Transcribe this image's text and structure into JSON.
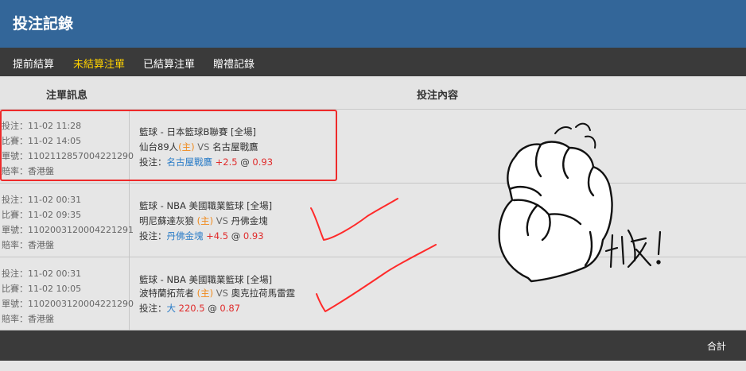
{
  "header": {
    "title": "投注記錄"
  },
  "tabs": [
    {
      "label": "提前結算",
      "active": false
    },
    {
      "label": "未結算注單",
      "active": true
    },
    {
      "label": "已結算注單",
      "active": false
    },
    {
      "label": "贈禮記錄",
      "active": false
    }
  ],
  "columns": {
    "info": "注單訊息",
    "content": "投注內容"
  },
  "bets": [
    {
      "bet_time": "投注：11-02 11:28",
      "match_time": "比賽：11-02 14:05",
      "slip_no": "單號：1102112857004221290",
      "odds_type": "賠率：香港盤",
      "league": "籃球 - 日本籃球B聯賽 [全場]",
      "home": "仙台89人",
      "home_tag": "(主)",
      "vs": "VS",
      "away": "名古屋戰鷹",
      "bet_label": "投注：",
      "selection": "名古屋戰鷹",
      "line": "+2.5",
      "at": "@",
      "odds": "0.93"
    },
    {
      "bet_time": "投注：11-02 00:31",
      "match_time": "比賽：11-02 09:35",
      "slip_no": "單號：1102003120004221291",
      "odds_type": "賠率：香港盤",
      "league": "籃球 - NBA 美國職業籃球 [全場]",
      "home": "明尼蘇達灰狼",
      "home_tag": "(主)",
      "vs": "VS",
      "away": "丹佛金塊",
      "bet_label": "投注：",
      "selection": "丹佛金塊",
      "line": "+4.5",
      "at": "@",
      "odds": "0.93"
    },
    {
      "bet_time": "投注：11-02 00:31",
      "match_time": "比賽：11-02 10:05",
      "slip_no": "單號：1102003120004221290",
      "odds_type": "賠率：香港盤",
      "league": "籃球 - NBA 美國職業籃球 [全場]",
      "home": "波特蘭拓荒者",
      "home_tag": "(主)",
      "vs": "VS",
      "away": "奧克拉荷馬雷霆",
      "bet_label": "投注：",
      "selection": "大",
      "line": "220.5",
      "at": "@",
      "odds": "0.87"
    }
  ],
  "footer": {
    "total_label": "合計"
  },
  "annotation": {
    "handwritten_text": "收!"
  },
  "colors": {
    "header": "#336699",
    "tab_active": "#ffd200",
    "dark_bar": "#3a3a3a",
    "selection_blue": "#2a7cc7",
    "odds_red": "#e02b2b",
    "home_orange": "#f08a1c",
    "highlight_box": "#ee2a2a"
  }
}
